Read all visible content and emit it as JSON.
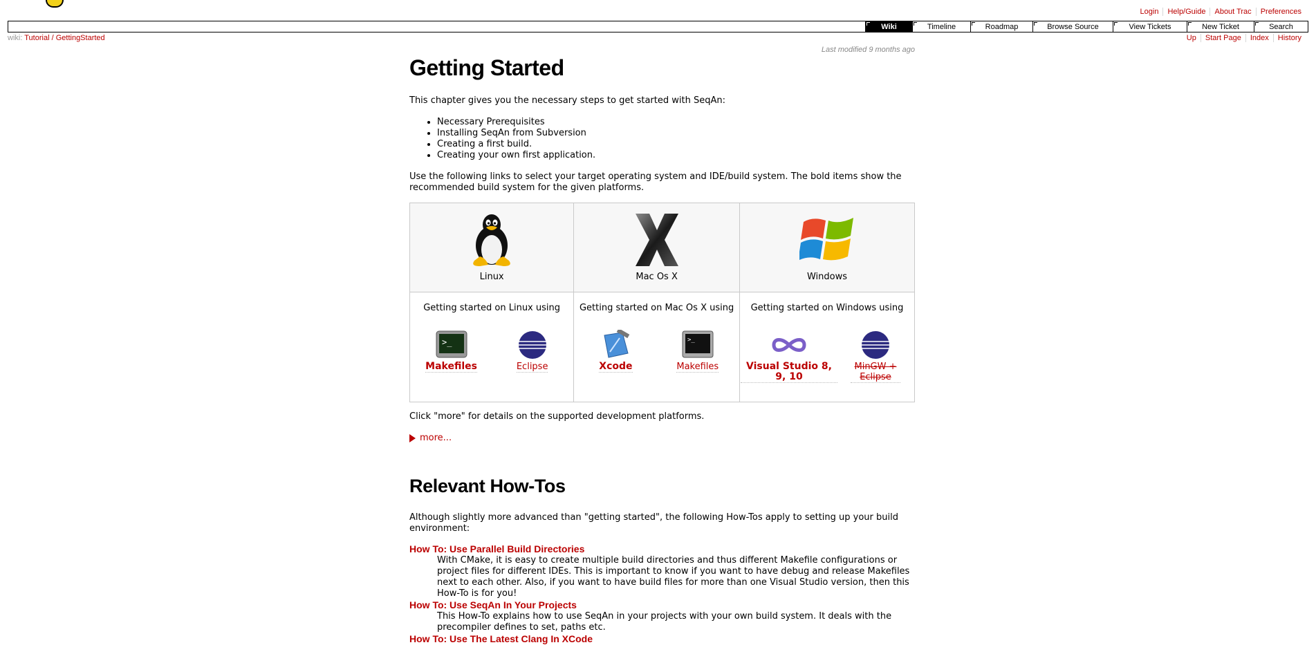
{
  "metanav": [
    "Login",
    "Help/Guide",
    "About Trac",
    "Preferences"
  ],
  "mainnav": {
    "items": [
      {
        "label": "Wiki",
        "active": true
      },
      {
        "label": "Timeline",
        "active": false
      },
      {
        "label": "Roadmap",
        "active": false
      },
      {
        "label": "Browse Source",
        "active": false
      },
      {
        "label": "View Tickets",
        "active": false
      },
      {
        "label": "New Ticket",
        "active": false
      },
      {
        "label": "Search",
        "active": false
      }
    ]
  },
  "breadcrumb": {
    "prefix": "wiki:",
    "path": [
      "Tutorial",
      "GettingStarted"
    ],
    "separator": "/"
  },
  "ctxnav": [
    "Up",
    "Start Page",
    "Index",
    "History"
  ],
  "last_modified": "Last modified 9 months ago",
  "page": {
    "title": "Getting Started",
    "intro": "This chapter gives you the necessary steps to get started with SeqAn:",
    "toc": [
      "Necessary Prerequisites",
      "Installing SeqAn from Subversion",
      "Creating a first build.",
      "Creating your own first application."
    ],
    "select_text": "Use the following links to select your target operating system and IDE/build system. The bold items show the recommended build system for the given platforms.",
    "platforms": [
      {
        "name": "Linux",
        "icon": "tux-penguin-icon",
        "using": "Getting started on Linux using",
        "tools": [
          {
            "label": "Makefiles",
            "icon": "terminal-icon",
            "bold": true,
            "strike": false
          },
          {
            "label": "Eclipse",
            "icon": "eclipse-icon",
            "bold": false,
            "strike": false
          }
        ]
      },
      {
        "name": "Mac Os X",
        "icon": "mac-os-x-icon",
        "using": "Getting started on Mac Os X using",
        "tools": [
          {
            "label": "Xcode",
            "icon": "xcode-icon",
            "bold": true,
            "strike": false
          },
          {
            "label": "Makefiles",
            "icon": "terminal-icon",
            "bold": false,
            "strike": false
          }
        ]
      },
      {
        "name": "Windows",
        "icon": "windows-logo-icon",
        "using": "Getting started on Windows using",
        "tools": [
          {
            "label": "Visual Studio 8, 9, 10",
            "icon": "visual-studio-icon",
            "bold": true,
            "strike": false
          },
          {
            "label": "MinGW + Eclipse",
            "icon": "eclipse-icon",
            "bold": false,
            "strike": true
          }
        ]
      }
    ],
    "more_hint": "Click \"more\" for details on the supported development platforms.",
    "more_link": "more...",
    "howtos_title": "Relevant How-Tos",
    "howtos_intro": "Although slightly more advanced than \"getting started\", the following How-Tos apply to setting up your build environment:",
    "howtos": [
      {
        "title": "How To: Use Parallel Build Directories",
        "desc": "With CMake, it is easy to create multiple build directories and thus different Makefile configurations or project files for different IDEs. This is important to know if you want to have debug and release Makefiles next to each other. Also, if you want to have build files for more than one Visual Studio version, then this How-To is for you!"
      },
      {
        "title": "How To: Use SeqAn In Your Projects",
        "desc": "This How-To explains how to use SeqAn in your projects with your own build system. It deals with the precompiler defines to set, paths etc."
      },
      {
        "title": "How To: Use The Latest Clang In XCode",
        "desc": ""
      }
    ]
  }
}
